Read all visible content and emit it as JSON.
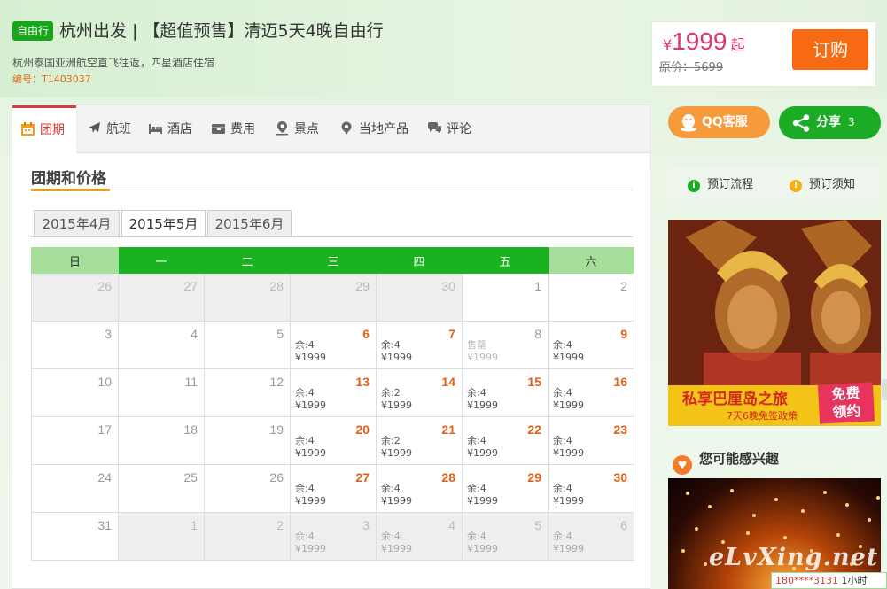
{
  "header": {
    "tag": "自由行",
    "title": "杭州出发 | 【超值预售】清迈5天4晚自由行",
    "subtitle": "杭州泰国亚洲航空直飞往返，四星酒店住宿",
    "code": "编号：T1403037"
  },
  "price": {
    "currency": "¥",
    "amount": "1999",
    "suffix": "起",
    "original": "原价：5699",
    "buy_label": "订购"
  },
  "tabs": [
    {
      "label": "团期",
      "icon": "calendar-icon"
    },
    {
      "label": "航班",
      "icon": "plane-icon"
    },
    {
      "label": "酒店",
      "icon": "bed-icon"
    },
    {
      "label": "费用",
      "icon": "wallet-icon"
    },
    {
      "label": "景点",
      "icon": "map-pin-icon"
    },
    {
      "label": "当地产品",
      "icon": "location-gear-icon"
    },
    {
      "label": "评论",
      "icon": "speech-bubble-icon"
    }
  ],
  "section_title": "团期和价格",
  "months": [
    "2015年4月",
    "2015年5月",
    "2015年6月"
  ],
  "active_month": 1,
  "weekdays": [
    "日",
    "一",
    "二",
    "三",
    "四",
    "五",
    "六"
  ],
  "calendar": [
    [
      {
        "d": "26",
        "t": "out"
      },
      {
        "d": "27",
        "t": "out"
      },
      {
        "d": "28",
        "t": "out"
      },
      {
        "d": "29",
        "t": "out"
      },
      {
        "d": "30",
        "t": "out"
      },
      {
        "d": "1",
        "t": "day"
      },
      {
        "d": "2",
        "t": "day"
      }
    ],
    [
      {
        "d": "3",
        "t": "day"
      },
      {
        "d": "4",
        "t": "day"
      },
      {
        "d": "5",
        "t": "day"
      },
      {
        "d": "6",
        "t": "hot",
        "a": "余:4",
        "p": "¥1999"
      },
      {
        "d": "7",
        "t": "hot",
        "a": "余:4",
        "p": "¥1999"
      },
      {
        "d": "8",
        "t": "sold",
        "a": "售罄",
        "p": "¥1999"
      },
      {
        "d": "9",
        "t": "hot",
        "a": "余:4",
        "p": "¥1999"
      }
    ],
    [
      {
        "d": "10",
        "t": "day"
      },
      {
        "d": "11",
        "t": "day"
      },
      {
        "d": "12",
        "t": "day"
      },
      {
        "d": "13",
        "t": "hot",
        "a": "余:4",
        "p": "¥1999"
      },
      {
        "d": "14",
        "t": "hot",
        "a": "余:2",
        "p": "¥1999"
      },
      {
        "d": "15",
        "t": "hot",
        "a": "余:4",
        "p": "¥1999"
      },
      {
        "d": "16",
        "t": "hot",
        "a": "余:4",
        "p": "¥1999"
      }
    ],
    [
      {
        "d": "17",
        "t": "day"
      },
      {
        "d": "18",
        "t": "day"
      },
      {
        "d": "19",
        "t": "day"
      },
      {
        "d": "20",
        "t": "hot",
        "a": "余:4",
        "p": "¥1999"
      },
      {
        "d": "21",
        "t": "hot",
        "a": "余:2",
        "p": "¥1999"
      },
      {
        "d": "22",
        "t": "hot",
        "a": "余:4",
        "p": "¥1999"
      },
      {
        "d": "23",
        "t": "hot",
        "a": "余:4",
        "p": "¥1999"
      }
    ],
    [
      {
        "d": "24",
        "t": "day"
      },
      {
        "d": "25",
        "t": "day"
      },
      {
        "d": "26",
        "t": "day"
      },
      {
        "d": "27",
        "t": "hot",
        "a": "余:4",
        "p": "¥1999"
      },
      {
        "d": "28",
        "t": "hot",
        "a": "余:4",
        "p": "¥1999"
      },
      {
        "d": "29",
        "t": "hot",
        "a": "余:4",
        "p": "¥1999"
      },
      {
        "d": "30",
        "t": "hot",
        "a": "余:4",
        "p": "¥1999"
      }
    ],
    [
      {
        "d": "31",
        "t": "day"
      },
      {
        "d": "1",
        "t": "out"
      },
      {
        "d": "2",
        "t": "out"
      },
      {
        "d": "3",
        "t": "outprice",
        "a": "余:4",
        "p": "¥1999"
      },
      {
        "d": "4",
        "t": "outprice",
        "a": "余:4",
        "p": "¥1999"
      },
      {
        "d": "5",
        "t": "outprice",
        "a": "余:4",
        "p": "¥1999"
      },
      {
        "d": "6",
        "t": "outprice",
        "a": "余:4",
        "p": "¥1999"
      }
    ]
  ],
  "sidebar": {
    "qq_label": "QQ客服",
    "share_label": "分享",
    "share_count": "3",
    "flow_label": "预订流程",
    "notice_label": "预订须知",
    "banner_title": "私享巴厘岛之旅",
    "banner_sub": "7天6晚免签政策",
    "banner_free": "免费\n领约",
    "interest_title": "您可能感兴趣",
    "watermark": "eLvXing.net",
    "ticker_phone": "180****3131",
    "ticker_text": "1小时"
  },
  "colors": {
    "accent_green": "#1bb220",
    "accent_orange": "#f76a12",
    "price_pink": "#d93a6a",
    "hot_date": "#e2601a"
  }
}
